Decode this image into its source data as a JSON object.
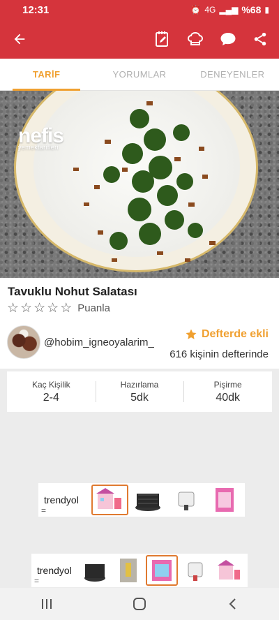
{
  "status": {
    "time": "12:31",
    "battery": "%68",
    "network": "4G"
  },
  "tabs": [
    {
      "label": "TARİF",
      "active": true
    },
    {
      "label": "YORUMLAR",
      "active": false
    },
    {
      "label": "DENEYENLER",
      "active": false
    }
  ],
  "hero": {
    "logo_main": "nefis",
    "logo_sub": "yemektarifleri"
  },
  "recipe": {
    "title": "Tavuklu Nohut Salatası",
    "rating_label": "Puanla",
    "stars": 5,
    "author": "@hobim_igneoyalarim_",
    "fav_label": "Defterde ekli",
    "fav_count": "616 kişinin defterinde"
  },
  "stats": [
    {
      "label": "Kaç Kişilik",
      "value": "2-4"
    },
    {
      "label": "Hazırlama",
      "value": "5dk"
    },
    {
      "label": "Pişirme",
      "value": "40dk"
    }
  ],
  "ads": [
    {
      "brand": "trendyol",
      "sub": "="
    },
    {
      "brand": "trendyol",
      "sub": "="
    }
  ],
  "colors": {
    "brand_red": "#d5343c",
    "accent_orange": "#f0a030"
  }
}
